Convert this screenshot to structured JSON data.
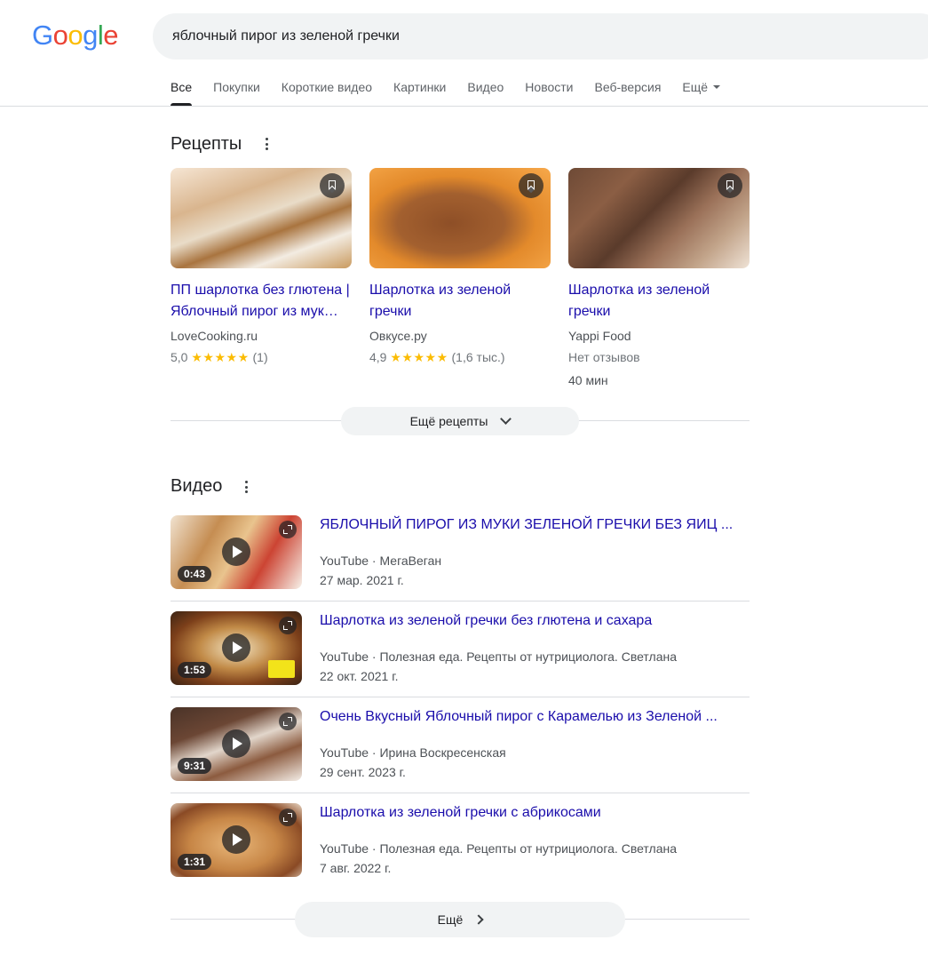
{
  "logo": {
    "letters": [
      "G",
      "o",
      "o",
      "g",
      "l",
      "e"
    ],
    "colors": [
      "#4285f4",
      "#ea4335",
      "#fbbc05",
      "#4285f4",
      "#34a853",
      "#ea4335"
    ]
  },
  "search": {
    "query": "яблочный пирог из зеленой гречки"
  },
  "tabs": [
    {
      "label": "Все",
      "active": true
    },
    {
      "label": "Покупки"
    },
    {
      "label": "Короткие видео"
    },
    {
      "label": "Картинки"
    },
    {
      "label": "Видео"
    },
    {
      "label": "Новости"
    },
    {
      "label": "Веб-версия"
    },
    {
      "label": "Ещё"
    }
  ],
  "recipes": {
    "title": "Рецепты",
    "items": [
      {
        "title": "ПП шарлотка без глютена | Яблочный пирог из мук…",
        "source": "LoveCooking.ru",
        "rating": "5,0",
        "stars": "★★★★★",
        "count": "(1)"
      },
      {
        "title": "Шарлотка из зеленой гречки",
        "source": "Овкусе.ру",
        "rating": "4,9",
        "stars": "★★★★★",
        "count": "(1,6 тыс.)"
      },
      {
        "title": "Шарлотка из зеленой гречки",
        "source": "Yappi Food",
        "rating_text": "Нет отзывов",
        "time": "40 мин"
      }
    ],
    "more_label": "Ещё рецепты"
  },
  "videos": {
    "title": "Видео",
    "items": [
      {
        "title": "ЯБЛОЧНЫЙ ПИРОГ ИЗ МУКИ ЗЕЛЕНОЙ ГРЕЧКИ БЕЗ ЯИЦ ...",
        "platform": "YouTube",
        "channel": "МегаВеган",
        "date": "27 мар. 2021 г.",
        "duration": "0:43"
      },
      {
        "title": "Шарлотка из зеленой гречки без глютена и сахара",
        "platform": "YouTube",
        "channel": "Полезная еда. Рецепты от нутрициолога. Светлана",
        "date": "22 окт. 2021 г.",
        "duration": "1:53"
      },
      {
        "title": "Очень Вкусный Яблочный пирог с Карамелью из Зеленой ...",
        "platform": "YouTube",
        "channel": "Ирина Воскресенская",
        "date": "29 сент. 2023 г.",
        "duration": "9:31"
      },
      {
        "title": "Шарлотка из зеленой гречки с абрикосами",
        "platform": "YouTube",
        "channel": "Полезная еда. Рецепты от нутрициолога. Светлана",
        "date": "7 авг. 2022 г.",
        "duration": "1:31"
      }
    ],
    "more_label": "Ещё",
    "separator": " · "
  },
  "icons": [
    "kebab-menu-icon",
    "bookmark-icon",
    "chevron-down-icon",
    "chevron-right-icon",
    "play-icon",
    "expand-icon",
    "dropdown-caret-icon"
  ]
}
